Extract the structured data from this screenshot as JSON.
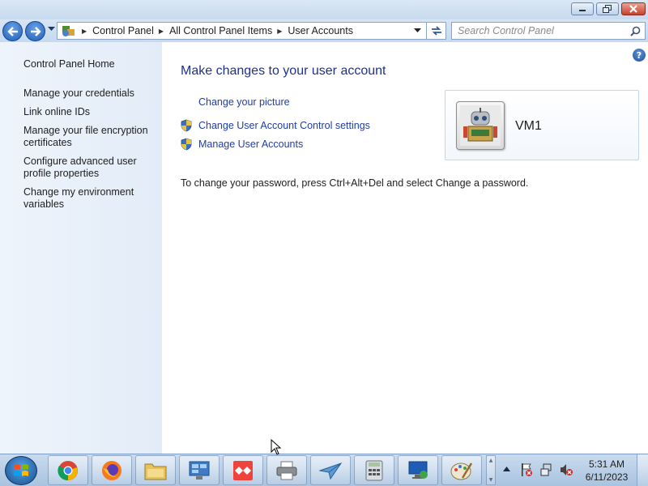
{
  "window": {
    "controls": {
      "minimize": "minimize-icon",
      "restore": "restore-icon",
      "close": "close-icon"
    }
  },
  "address_bar": {
    "icon": "control-panel-icon",
    "breadcrumbs": [
      "Control Panel",
      "All Control Panel Items",
      "User Accounts"
    ],
    "search_placeholder": "Search Control Panel"
  },
  "sidebar": {
    "home": "Control Panel Home",
    "tasks": [
      "Manage your credentials",
      "Link online IDs",
      "Manage your file encryption certificates",
      "Configure advanced user profile properties",
      "Change my environment variables"
    ]
  },
  "main": {
    "heading": "Make changes to your user account",
    "links": [
      {
        "label": "Change your picture",
        "icon": null
      },
      {
        "label": "Change User Account Control settings",
        "icon": "uac-shield-icon"
      },
      {
        "label": "Manage User Accounts",
        "icon": "uac-shield-icon"
      }
    ],
    "password_note": "To change your password, press Ctrl+Alt+Del and select Change a password.",
    "user": {
      "name": "VM1",
      "picture": "robot-avatar"
    }
  },
  "taskbar": {
    "apps": [
      "chrome-icon",
      "firefox-icon",
      "file-explorer-icon",
      "control-panel-icon",
      "anydesk-icon",
      "printer-icon",
      "paper-plane-icon",
      "calculator-icon",
      "remote-desktop-icon",
      "paint-icon"
    ],
    "tray": [
      "action-center-flag-icon",
      "network-icon",
      "volume-muted-icon"
    ],
    "clock": {
      "time": "5:31 AM",
      "date": "6/11/2023"
    }
  },
  "colors": {
    "link": "#1e3ea8",
    "heading": "#1e3287",
    "sidebar_bg": "#e8f0fa",
    "taskbar_bg": "#b9cfe7"
  }
}
